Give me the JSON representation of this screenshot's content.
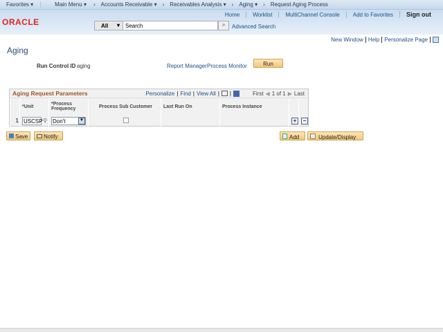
{
  "menubar": {
    "favorites": "Favorites",
    "main_menu": "Main Menu",
    "crumbs": [
      "Accounts Receivable",
      "Receivables Analysis",
      "Aging",
      "Request Aging Process"
    ]
  },
  "header": {
    "logo": "ORACLE",
    "links": [
      "Home",
      "Worklist",
      "MultiChannel Console",
      "Add to Favorites"
    ],
    "sign_out": "Sign out",
    "search_scope": "All",
    "search_placeholder": "Search",
    "advanced_search": "Advanced Search"
  },
  "page_links": {
    "new_window": "New Window",
    "help": "Help",
    "personalize_page": "Personalize Page"
  },
  "page": {
    "title": "Aging",
    "run_control_label": "Run Control ID",
    "run_control_value": "aging",
    "report_manager": "Report Manager",
    "process_monitor": "Process Monitor",
    "run": "Run"
  },
  "grid": {
    "title": "Aging Request Parameters",
    "personalize": "Personalize",
    "find": "Find",
    "view_all": "View All",
    "first": "First",
    "count": "1 of 1",
    "last": "Last",
    "columns": [
      "*Unit",
      "*Process Frequency",
      "Process Sub Customer",
      "Last Run On",
      "Process Instance"
    ],
    "rows": [
      {
        "num": "1",
        "unit": "USCSP",
        "frequency": "Don't",
        "sub_customer": false,
        "last_run": "",
        "instance": ""
      }
    ]
  },
  "buttons": {
    "save": "Save",
    "notify": "Notify",
    "add": "Add",
    "update_display": "Update/Display"
  }
}
